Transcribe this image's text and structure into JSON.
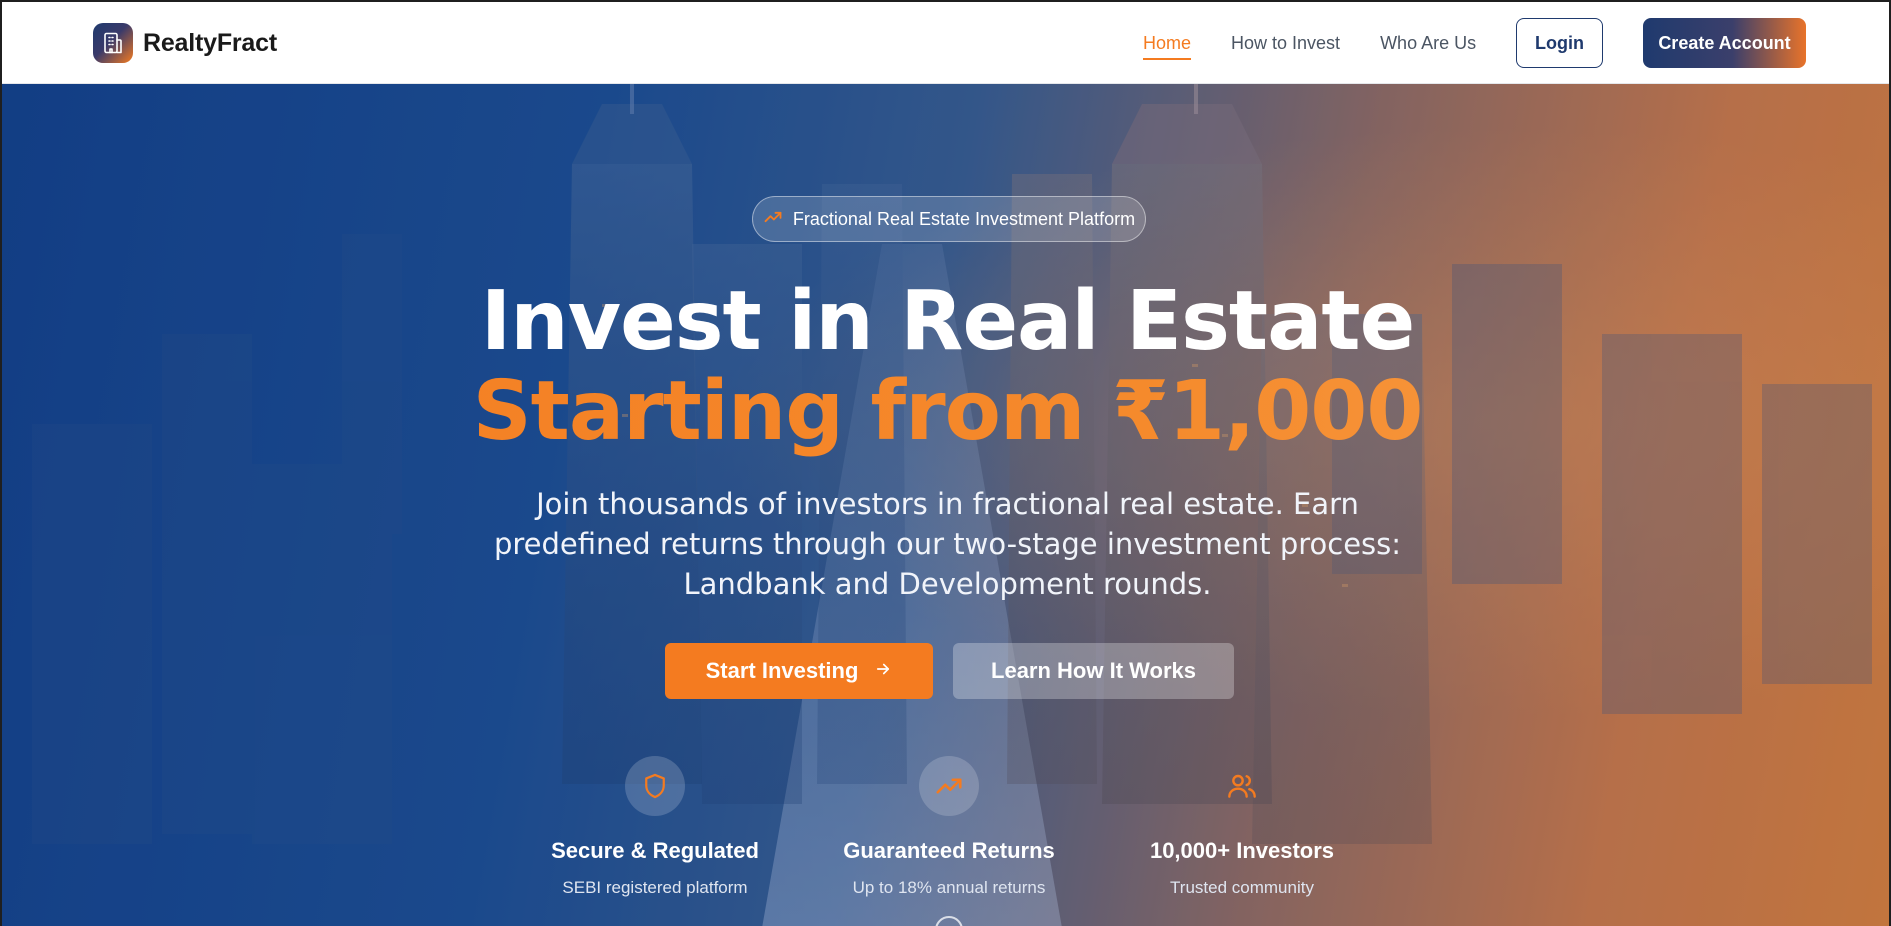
{
  "brand": {
    "name": "RealtyFract",
    "logo_icon": "building-icon"
  },
  "nav": {
    "links": [
      {
        "label": "Home",
        "active": true
      },
      {
        "label": "How to Invest",
        "active": false
      },
      {
        "label": "Who Are Us",
        "active": false
      }
    ],
    "login_label": "Login",
    "create_account_label": "Create Account"
  },
  "hero": {
    "badge": {
      "icon": "trending-up-icon",
      "label": "Fractional Real Estate Investment Platform"
    },
    "headline_line1": "Invest in Real Estate",
    "headline_line2": "Starting from ₹1,000",
    "subtitle": "Join thousands of investors in fractional real estate. Earn predefined returns through our two-stage investment process: Landbank and Development rounds.",
    "primary_cta": {
      "label": "Start Investing",
      "icon": "arrow-right-icon"
    },
    "secondary_cta": {
      "label": "Learn How It Works"
    },
    "features": [
      {
        "icon": "shield-icon",
        "title": "Secure & Regulated",
        "subtitle": "SEBI registered platform"
      },
      {
        "icon": "trending-up-icon",
        "title": "Guaranteed Returns",
        "subtitle": "Up to 18% annual returns"
      },
      {
        "icon": "users-icon",
        "title": "10,000+ Investors",
        "subtitle": "Trusted community"
      }
    ]
  },
  "colors": {
    "accent": "#f47b20",
    "navy": "#1f3a6e",
    "hero_blue": "#123d86",
    "hero_orange": "#e8802f"
  }
}
